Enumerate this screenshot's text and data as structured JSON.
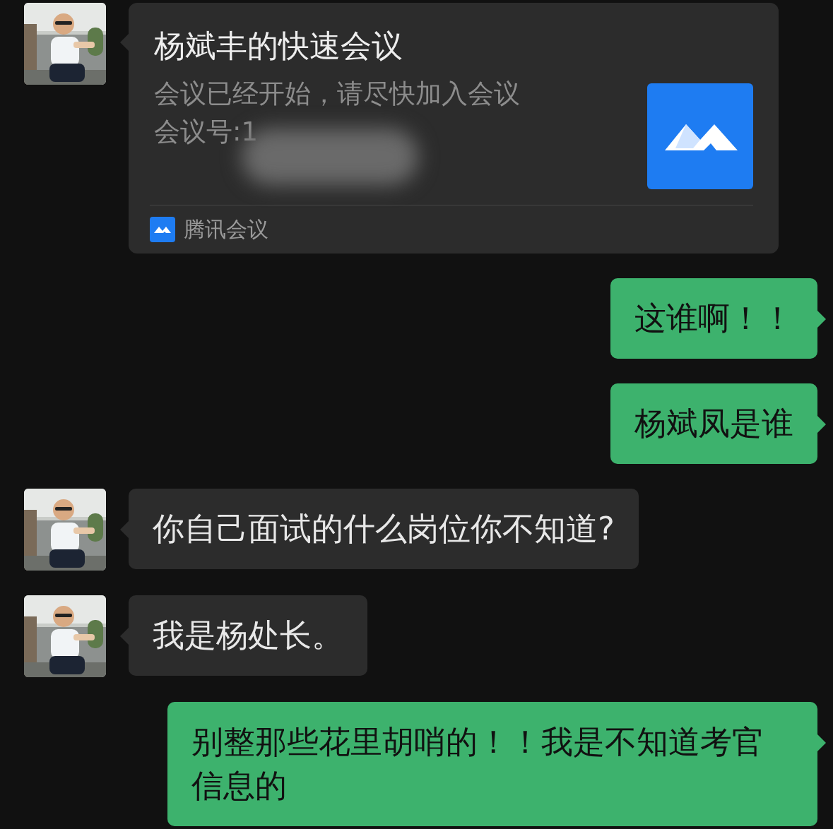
{
  "messages": [
    {
      "kind": "card",
      "outgoing": false,
      "title": "杨斌丰的快速会议",
      "lines": [
        "会议已经开始，请尽快加入会议",
        "会议号:1"
      ],
      "redacted": true,
      "source": "腾讯会议"
    },
    {
      "kind": "text",
      "outgoing": true,
      "text": "这谁啊！！"
    },
    {
      "kind": "text",
      "outgoing": true,
      "text": "杨斌凤是谁"
    },
    {
      "kind": "text",
      "outgoing": false,
      "text": "你自己面试的什么岗位你不知道?"
    },
    {
      "kind": "text",
      "outgoing": false,
      "text": "我是杨处长。"
    },
    {
      "kind": "text",
      "outgoing": true,
      "text": "别整那些花里胡哨的！！我是不知道考官信息的"
    }
  ]
}
